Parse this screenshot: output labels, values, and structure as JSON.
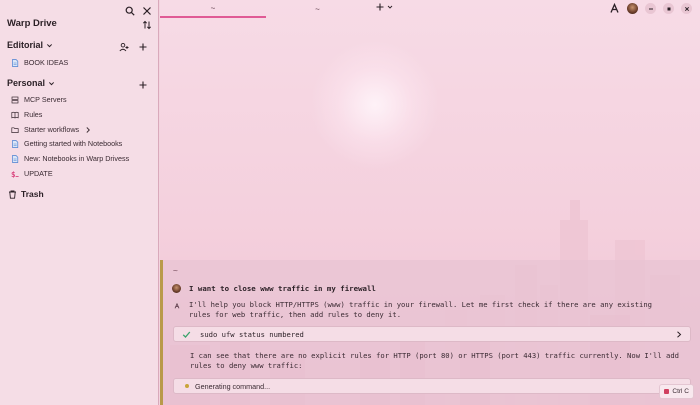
{
  "sidebar": {
    "title": "Warp Drive",
    "editorial": {
      "label": "Editorial",
      "items": [
        {
          "label": "BOOK IDEAS",
          "icon": "document-icon"
        }
      ]
    },
    "personal": {
      "label": "Personal",
      "items": [
        {
          "label": "MCP Servers",
          "icon": "server-icon"
        },
        {
          "label": "Rules",
          "icon": "book-icon"
        },
        {
          "label": "Starter workflows",
          "icon": "folder-icon"
        },
        {
          "label": "Getting started with Notebooks",
          "icon": "document-icon"
        },
        {
          "label": "New: Notebooks in Warp Drivess",
          "icon": "document-icon"
        },
        {
          "label": "UPDATE",
          "icon": "terminal-icon"
        }
      ]
    },
    "trash_label": "Trash"
  },
  "tabs": [
    {
      "label": "~"
    },
    {
      "label": "~"
    }
  ],
  "terminal": {
    "prompt_dir": "~",
    "user_query": "I want to close www traffic in my firewall",
    "ai_message_1": "I'll help you block HTTP/HTTPS (www) traffic in your firewall. Let me first check if there are any existing rules for web traffic, then add rules to deny it.",
    "command": "sudo ufw status numbered",
    "ai_message_2": "I can see that there are no explicit rules for HTTP (port 80) or HTTPS (port 443) traffic currently. Now I'll add rules to deny www traffic:",
    "generating_label": "Generating command...",
    "cancel_shortcut": "Ctrl C"
  },
  "colors": {
    "accent": "#e05a95",
    "block_border": "#b99a4a",
    "check": "#3aa36b",
    "update_icon": "#d9467f"
  }
}
